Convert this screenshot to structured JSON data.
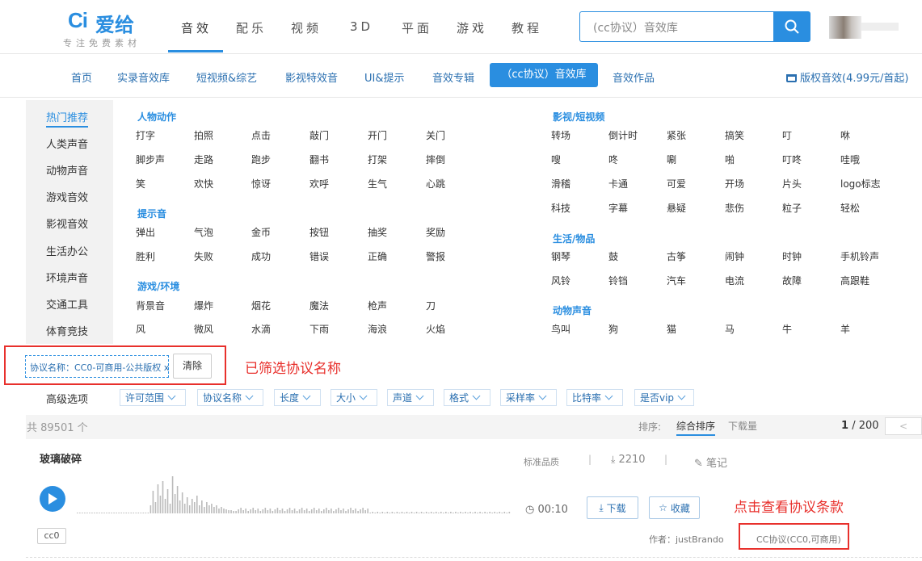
{
  "brand": {
    "mark": "Ci",
    "name": "爱给",
    "slogan": "专注免费素材",
    "accent": "#2a8ee0"
  },
  "topnav": [
    "音效",
    "配乐",
    "视频",
    "3D",
    "平面",
    "游戏",
    "教程"
  ],
  "search": {
    "placeholder": "(cc协议）音效库"
  },
  "subnav": [
    "首页",
    "实录音效库",
    "短视频&综艺",
    "影视特效音",
    "UI&提示",
    "音效专辑",
    "（cc协议）音效库",
    "音效作品"
  ],
  "copyright_link": "版权音效(4.99元/首起)",
  "sidebar": [
    "热门推荐",
    "人类声音",
    "动物声音",
    "游戏音效",
    "影视音效",
    "生活办公",
    "环境声音",
    "交通工具",
    "体育竞技"
  ],
  "groups": [
    {
      "title": "人物动作",
      "tags": [
        "打字",
        "拍照",
        "点击",
        "敲门",
        "开门",
        "关门",
        "脚步声",
        "走路",
        "跑步",
        "翻书",
        "打架",
        "摔倒",
        "笑",
        "欢快",
        "惊讶",
        "欢呼",
        "生气",
        "心跳"
      ]
    },
    {
      "title": "提示音",
      "tags": [
        "弹出",
        "气泡",
        "金币",
        "按钮",
        "抽奖",
        "奖励",
        "胜利",
        "失败",
        "成功",
        "错误",
        "正确",
        "警报"
      ]
    },
    {
      "title": "游戏/环境",
      "tags": [
        "背景音",
        "爆炸",
        "烟花",
        "魔法",
        "枪声",
        "刀",
        "风",
        "微风",
        "水滴",
        "下雨",
        "海浪",
        "火焰"
      ]
    },
    {
      "title": "影视/短视频",
      "tags": [
        "转场",
        "倒计时",
        "紧张",
        "搞笑",
        "叮",
        "咻",
        "嗖",
        "咚",
        "唰",
        "啪",
        "叮咚",
        "哇哦",
        "滑稽",
        "卡通",
        "可爱",
        "开场",
        "片头",
        "logo标志",
        "科技",
        "字幕",
        "悬疑",
        "悲伤",
        "粒子",
        "轻松"
      ]
    },
    {
      "title": "生活/物品",
      "tags": [
        "钢琴",
        "鼓",
        "古筝",
        "闹钟",
        "时钟",
        "手机铃声",
        "风铃",
        "铃铛",
        "汽车",
        "电流",
        "故障",
        "高跟鞋"
      ]
    },
    {
      "title": "动物声音",
      "tags": [
        "鸟叫",
        "狗",
        "猫",
        "马",
        "牛",
        "羊"
      ]
    }
  ],
  "filter": {
    "chip": "协议名称：CC0-可商用-公共版权 x",
    "clear": "清除",
    "annotation": "已筛选协议名称"
  },
  "advanced": {
    "label": "高级选项",
    "dropdowns": [
      "许可范围",
      "协议名称",
      "长度",
      "大小",
      "声道",
      "格式",
      "采样率",
      "比特率",
      "是否vip"
    ]
  },
  "results": {
    "total": "共 89501 个",
    "sort_label": "排序:",
    "sort_active": "综合排序",
    "sort_other": "下载量",
    "page": "1",
    "page_total": "/ 200",
    "prev": "<"
  },
  "item": {
    "title": "玻璃破碎",
    "quality": "标准品质",
    "sep": "|",
    "downloads": "2210",
    "note": "笔记",
    "duration": "00:10",
    "download_btn": "下载",
    "fav_btn": "收藏",
    "tag": "cc0",
    "author": "作者：justBrando",
    "license": "CC协议(CC0,可商用)",
    "annotation": "点击查看协议条款"
  }
}
